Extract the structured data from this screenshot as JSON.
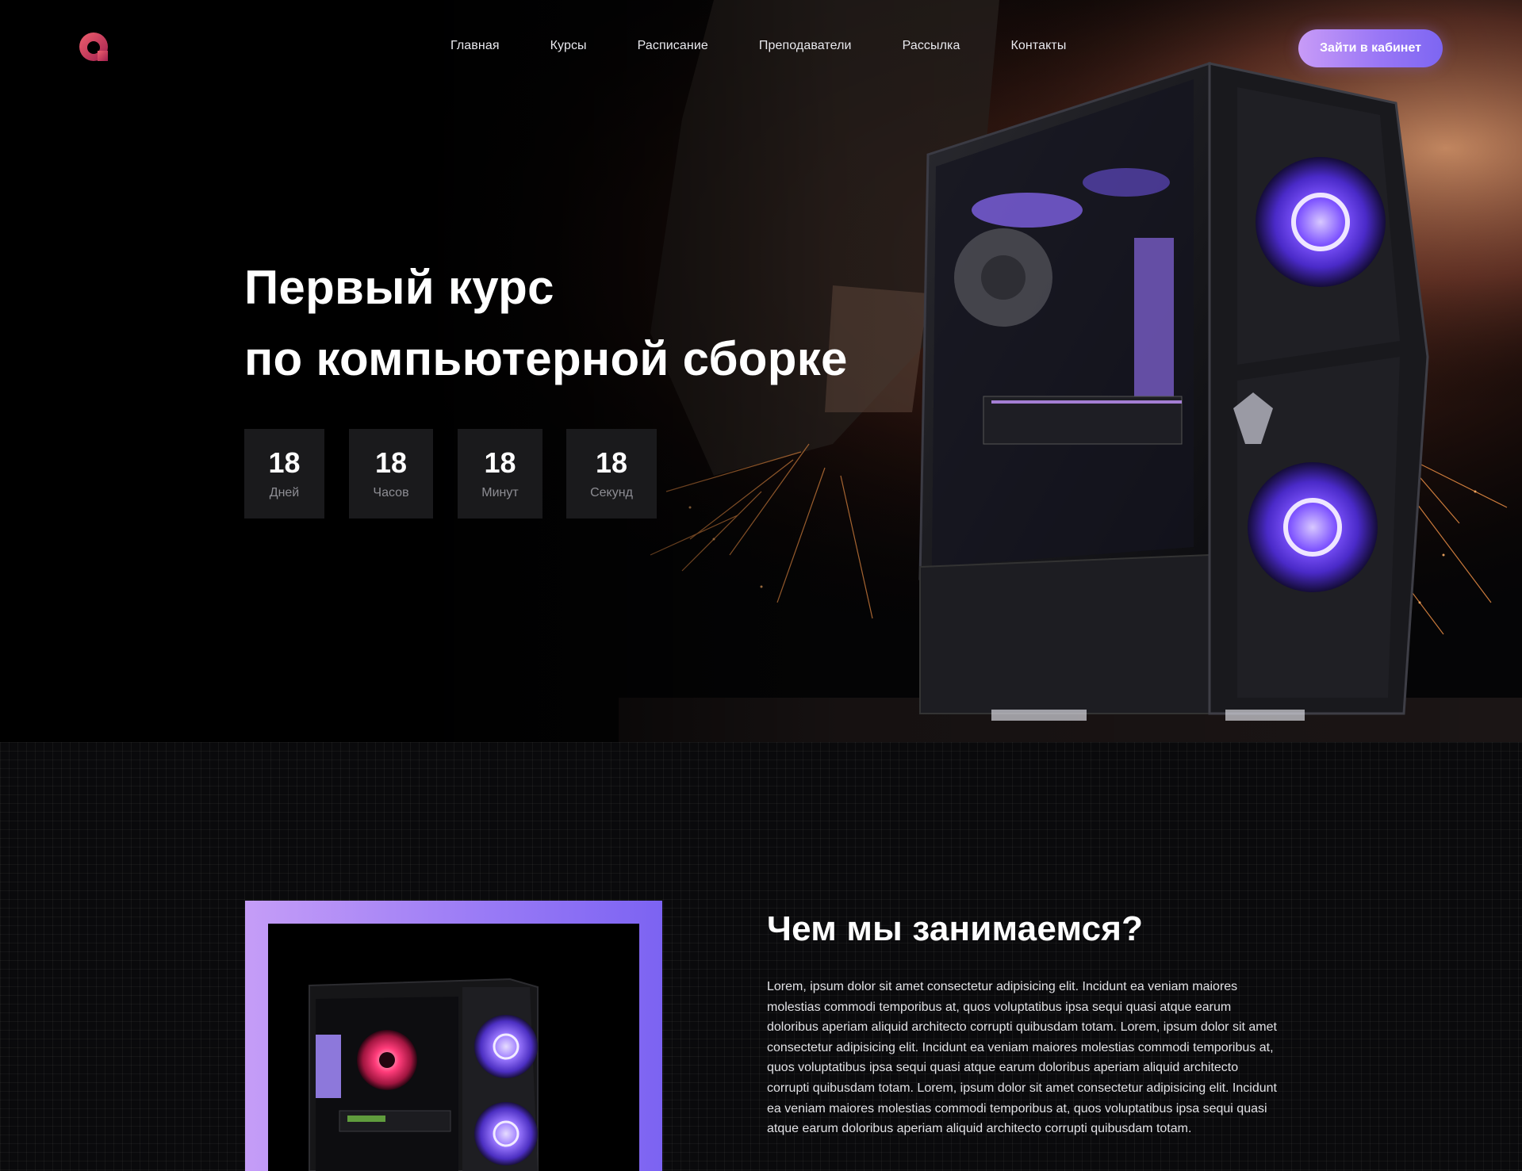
{
  "header": {
    "logo_icon": "q-ring-logo",
    "nav": [
      {
        "label": "Главная"
      },
      {
        "label": "Курсы"
      },
      {
        "label": "Расписание"
      },
      {
        "label": "Преподаватели"
      },
      {
        "label": "Рассылка"
      },
      {
        "label": "Контакты"
      }
    ],
    "cabinet_button": "Зайти в кабинет"
  },
  "hero": {
    "title_line1": "Первый курс",
    "title_line2": "по компьютерной сборке",
    "countdown": [
      {
        "value": "18",
        "label": "Дней"
      },
      {
        "value": "18",
        "label": "Часов"
      },
      {
        "value": "18",
        "label": "Минут"
      },
      {
        "value": "18",
        "label": "Секунд"
      }
    ],
    "background": "welder-with-sparks-and-pc-case-photo"
  },
  "about": {
    "title": "Чем мы занимаемся?",
    "text": "Lorem, ipsum dolor sit amet consectetur adipisicing elit. Incidunt ea veniam maiores molestias commodi temporibus at, quos voluptatibus ipsa sequi quasi atque earum doloribus aperiam aliquid architecto corrupti quibusdam totam. Lorem, ipsum dolor sit amet consectetur adipisicing elit. Incidunt ea veniam maiores molestias commodi temporibus at, quos voluptatibus ipsa sequi quasi atque earum doloribus aperiam aliquid architecto corrupti quibusdam totam. Lorem, ipsum dolor sit amet consectetur adipisicing elit. Incidunt ea veniam maiores molestias commodi temporibus at, quos voluptatibus ipsa sequi quasi atque earum doloribus aperiam aliquid architecto corrupti quibusdam totam.",
    "image": "rgb-pc-case-photo"
  },
  "colors": {
    "accent_start": "#c89bf7",
    "accent_end": "#7d66f2",
    "background": "#000000",
    "countdown_box": "#1c1c1e"
  }
}
